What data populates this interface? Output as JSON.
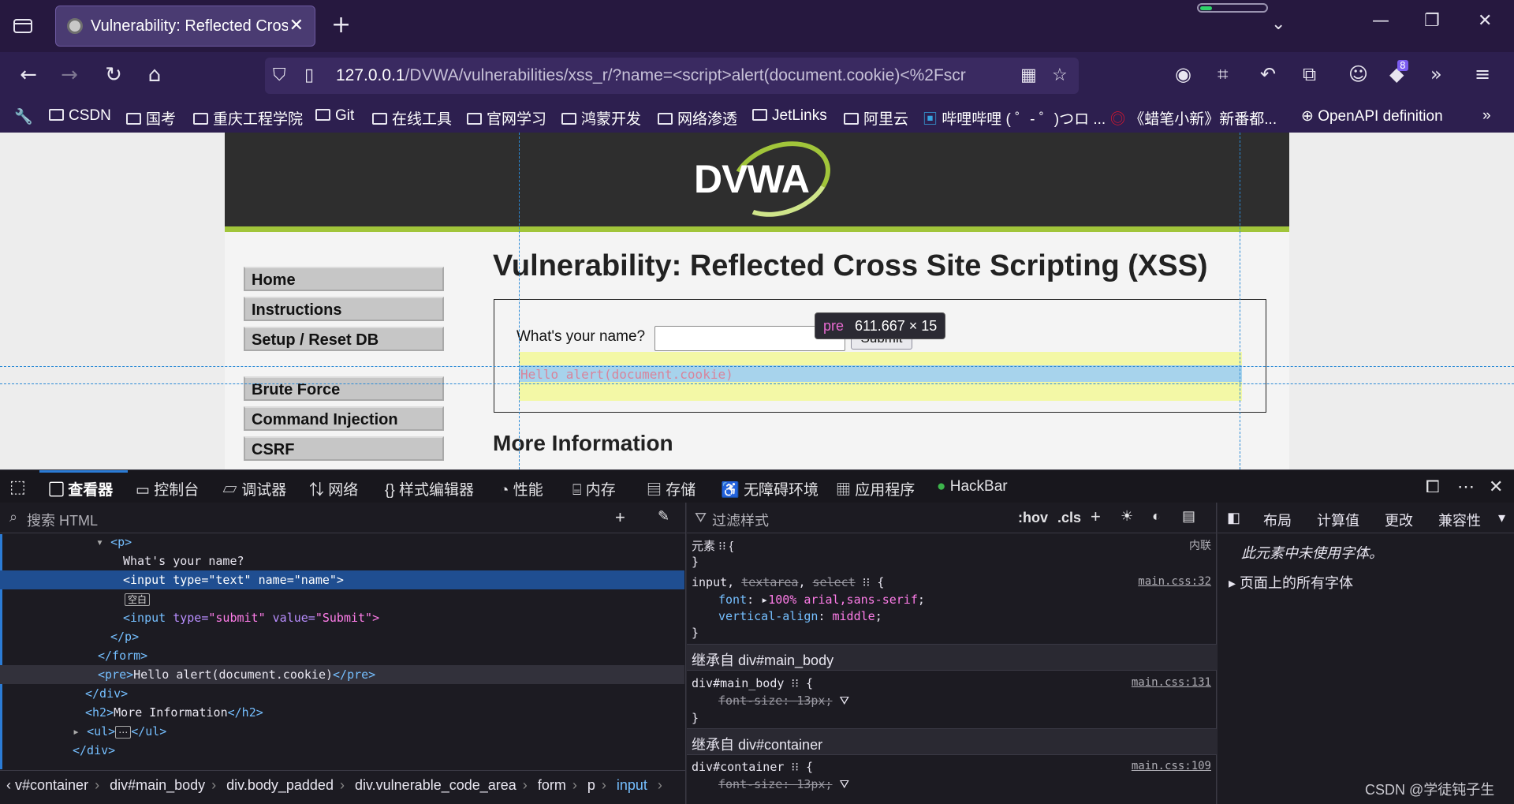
{
  "browser": {
    "tab_title": "Vulnerability: Reflected Cross Site Scripting (XSS)",
    "url_host": "127.0.0.1",
    "url_rest": "/DVWA/vulnerabilities/xss_r/?name=<script>alert(document.cookie)<%2Fscr",
    "extension_badge": "8",
    "memory_fraction": 0.18,
    "bookmarks": [
      "CSDN",
      "国考",
      "重庆工程学院",
      "Git",
      "在线工具",
      "官网学习",
      "鸿蒙开发",
      "网络渗透",
      "JetLinks",
      "阿里云",
      "哔哩哔哩 ( ゜- ゜)つロ ...",
      "《蜡笔小新》新番都...",
      "OpenAPI definition"
    ]
  },
  "dvwa": {
    "logo": "DVWA",
    "menu": [
      "Home",
      "Instructions",
      "Setup / Reset DB",
      "Brute Force",
      "Command Injection",
      "CSRF"
    ],
    "heading": "Vulnerability: Reflected Cross Site Scripting (XSS)",
    "question": "What's your name?",
    "submit": "Submit",
    "output": "Hello alert(document.cookie)",
    "more_info": "More Information"
  },
  "tooltip": {
    "tag": "pre",
    "dims": "611.667 × 15"
  },
  "devtools": {
    "tabs": [
      "查看器",
      "控制台",
      "调试器",
      "网络",
      "样式编辑器",
      "性能",
      "内存",
      "存储",
      "无障碍环境",
      "应用程序",
      "HackBar"
    ],
    "search_placeholder": "搜索 HTML",
    "filter_placeholder": "过滤样式",
    "hov": ":hov",
    "cls": ".cls",
    "markup": {
      "p_open": "<p>",
      "text": "What's your name?",
      "input_tag": "<input",
      "input_attr1": "type=",
      "input_val1": "\"text\"",
      "input_attr2": "name=",
      "input_val2": "\"name\">",
      "blank": "空白",
      "submit_tag": "<input",
      "submit_attr1": "type=",
      "submit_val1": "\"submit\"",
      "submit_attr2": "value=",
      "submit_val2": "\"Submit\">",
      "p_close": "</p>",
      "form_close": "</form>",
      "pre_open": "<pre>",
      "pre_text": "Hello alert(document.cookie)",
      "pre_close": "</pre>",
      "div_close": "</div>",
      "h2_open": "<h2>",
      "h2_text": "More Information",
      "h2_close": "</h2>",
      "ul_open": "<ul>",
      "ul_dots": "⋯",
      "ul_close": "</ul>",
      "div_close2": "</div>"
    },
    "breadcrumbs": [
      "v#container",
      "div#main_body",
      "div.body_padded",
      "div.vulnerable_code_area",
      "form",
      "p",
      "input"
    ],
    "rules": {
      "element_label": "元素",
      "inline_label": "内联",
      "rule1_selector_a": "input, ",
      "rule1_selector_b": "textarea",
      "rule1_selector_sep": ", ",
      "rule1_selector_c": "select",
      "rule1_src": "main.css:32",
      "rule1_prop1": "font",
      "rule1_val1": "100% arial,sans-serif",
      "rule1_prop2": "vertical-align",
      "rule1_val2": "middle",
      "inherit1": "继承自 div#main_body",
      "rule2_selector": "div#main_body",
      "rule2_src": "main.css:131",
      "rule2_prop": "font-size: 13px;",
      "inherit2": "继承自 div#container",
      "rule3_selector": "div#container",
      "rule3_src": "main.css:109",
      "rule3_prop": "font-size: 13px;"
    },
    "side_tabs": [
      "布局",
      "计算值",
      "更改",
      "兼容性"
    ],
    "fonts_msg": "此元素中未使用字体。",
    "all_fonts": "页面上的所有字体",
    "watermark": "CSDN @学徒钝子生"
  }
}
